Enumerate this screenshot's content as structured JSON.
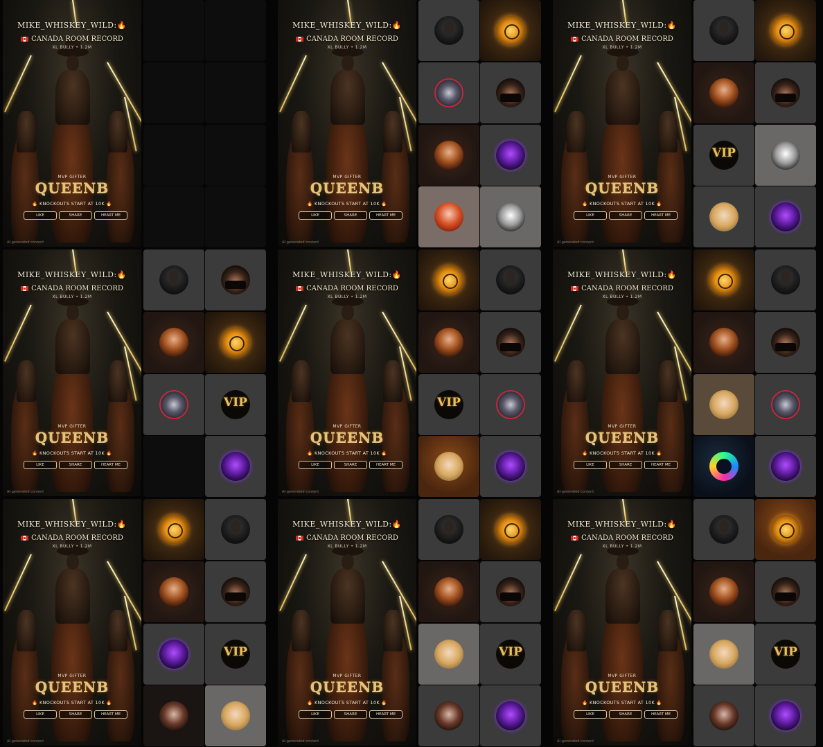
{
  "poster": {
    "name": "MIKE_WHISKEY_WILD:",
    "fire_emoji": "🔥",
    "record": "CANADA ROOM RECORD",
    "subtitle": "XL BULLY • 1.2M",
    "gifter_label": "MVP GIFTER",
    "gifter_name": "QUEENB",
    "knockouts": "KNOCKOUTS START AT 10K",
    "buttons": [
      "LIKE",
      "SHARE",
      "HEART ME"
    ],
    "ai_notice": "AI-generated content"
  },
  "panels": [
    {
      "tiles": [
        {
          "style": "empty",
          "avatar": "none",
          "icon": "empty-slot"
        },
        {
          "style": "empty",
          "avatar": "none",
          "icon": "empty-slot"
        },
        {
          "style": "empty",
          "avatar": "none",
          "icon": "empty-slot"
        },
        {
          "style": "empty",
          "avatar": "none",
          "icon": "empty-slot"
        },
        {
          "style": "empty",
          "avatar": "none",
          "icon": "empty-slot"
        },
        {
          "style": "empty",
          "avatar": "none",
          "icon": "empty-slot"
        },
        {
          "style": "empty",
          "avatar": "none",
          "icon": "empty-slot"
        },
        {
          "style": "empty",
          "avatar": "none",
          "icon": "empty-slot"
        }
      ]
    },
    {
      "tiles": [
        {
          "style": "grey",
          "avatar": "dark",
          "icon": "user-avatar"
        },
        {
          "style": "gold",
          "avatar": "gold",
          "icon": "gold-crest-avatar"
        },
        {
          "style": "grey",
          "avatar": "mil",
          "icon": "mil-badge-avatar"
        },
        {
          "style": "grey",
          "avatar": "mask",
          "icon": "masked-user-avatar"
        },
        {
          "style": "warm",
          "avatar": "fire",
          "icon": "user-avatar"
        },
        {
          "style": "grey",
          "avatar": "cup",
          "icon": "cup-of-tea-avatar"
        },
        {
          "style": "pale",
          "avatar": "red",
          "icon": "redhead-user-avatar"
        },
        {
          "style": "lightgrey",
          "avatar": "white",
          "icon": "white-figure-avatar"
        }
      ]
    },
    {
      "tiles": [
        {
          "style": "grey",
          "avatar": "dark",
          "icon": "user-avatar"
        },
        {
          "style": "gold",
          "avatar": "gold",
          "icon": "gold-crest-avatar"
        },
        {
          "style": "warm",
          "avatar": "fire",
          "icon": "user-avatar"
        },
        {
          "style": "grey",
          "avatar": "mask",
          "icon": "masked-user-avatar"
        },
        {
          "style": "grey",
          "avatar": "vip",
          "icon": "vip-avatar"
        },
        {
          "style": "lightgrey",
          "avatar": "white",
          "icon": "white-figure-avatar"
        },
        {
          "style": "grey",
          "avatar": "blonde",
          "icon": "blonde-user-avatar"
        },
        {
          "style": "grey",
          "avatar": "cup",
          "icon": "cup-of-tea-avatar"
        }
      ]
    },
    {
      "tiles": [
        {
          "style": "grey",
          "avatar": "dark",
          "icon": "user-avatar"
        },
        {
          "style": "grey",
          "avatar": "mask",
          "icon": "masked-user-avatar"
        },
        {
          "style": "warm",
          "avatar": "fire",
          "icon": "user-avatar"
        },
        {
          "style": "gold",
          "avatar": "gold",
          "icon": "gold-crest-avatar"
        },
        {
          "style": "grey",
          "avatar": "mil",
          "icon": "mil-badge-avatar"
        },
        {
          "style": "grey",
          "avatar": "vip",
          "icon": "vip-avatar"
        },
        {
          "style": "empty",
          "avatar": "none",
          "icon": "empty-slot"
        },
        {
          "style": "grey",
          "avatar": "cup",
          "icon": "cup-of-tea-avatar"
        }
      ]
    },
    {
      "tiles": [
        {
          "style": "gold",
          "avatar": "gold",
          "icon": "gold-crest-avatar"
        },
        {
          "style": "grey",
          "avatar": "dark",
          "icon": "user-avatar"
        },
        {
          "style": "warm",
          "avatar": "fire",
          "icon": "user-avatar"
        },
        {
          "style": "grey",
          "avatar": "mask",
          "icon": "masked-user-avatar"
        },
        {
          "style": "grey",
          "avatar": "vip",
          "icon": "vip-avatar"
        },
        {
          "style": "grey",
          "avatar": "mil",
          "icon": "mil-badge-avatar"
        },
        {
          "style": "amber",
          "avatar": "blonde",
          "icon": "blonde-user-avatar"
        },
        {
          "style": "grey",
          "avatar": "cup",
          "icon": "cup-of-tea-avatar"
        }
      ]
    },
    {
      "tiles": [
        {
          "style": "gold",
          "avatar": "gold",
          "icon": "gold-crest-avatar"
        },
        {
          "style": "grey",
          "avatar": "dark",
          "icon": "user-avatar"
        },
        {
          "style": "warm",
          "avatar": "fire",
          "icon": "user-avatar"
        },
        {
          "style": "grey",
          "avatar": "mask",
          "icon": "masked-user-avatar"
        },
        {
          "style": "brown",
          "avatar": "blonde",
          "icon": "blonde-user-avatar"
        },
        {
          "style": "grey",
          "avatar": "mil",
          "icon": "mil-badge-avatar"
        },
        {
          "style": "neon",
          "avatar": "neon",
          "icon": "neon-badge-avatar"
        },
        {
          "style": "grey",
          "avatar": "cup",
          "icon": "cup-of-tea-avatar"
        }
      ]
    },
    {
      "tiles": [
        {
          "style": "gold",
          "avatar": "gold",
          "icon": "gold-crest-avatar"
        },
        {
          "style": "grey",
          "avatar": "dark",
          "icon": "user-avatar"
        },
        {
          "style": "warm",
          "avatar": "fire",
          "icon": "user-avatar"
        },
        {
          "style": "grey",
          "avatar": "mask",
          "icon": "masked-user-avatar"
        },
        {
          "style": "grey",
          "avatar": "cup",
          "icon": "cup-of-tea-avatar"
        },
        {
          "style": "grey",
          "avatar": "vip",
          "icon": "vip-avatar"
        },
        {
          "style": "dark",
          "avatar": "glasses",
          "icon": "glasses-user-avatar"
        },
        {
          "style": "lightgrey",
          "avatar": "blonde",
          "icon": "blonde-user-avatar"
        }
      ]
    },
    {
      "tiles": [
        {
          "style": "grey",
          "avatar": "dark",
          "icon": "user-avatar"
        },
        {
          "style": "gold",
          "avatar": "gold",
          "icon": "gold-crest-avatar"
        },
        {
          "style": "warm",
          "avatar": "fire",
          "icon": "user-avatar"
        },
        {
          "style": "grey",
          "avatar": "mask",
          "icon": "masked-user-avatar"
        },
        {
          "style": "lightgrey",
          "avatar": "blonde",
          "icon": "blonde-user-avatar"
        },
        {
          "style": "grey",
          "avatar": "vip",
          "icon": "vip-avatar"
        },
        {
          "style": "grey",
          "avatar": "glasses",
          "icon": "glasses-user-avatar"
        },
        {
          "style": "grey",
          "avatar": "cup",
          "icon": "cup-of-tea-avatar"
        }
      ]
    },
    {
      "tiles": [
        {
          "style": "grey",
          "avatar": "dark",
          "icon": "user-avatar"
        },
        {
          "style": "amber",
          "avatar": "gold",
          "icon": "gold-crest-avatar"
        },
        {
          "style": "warm",
          "avatar": "fire",
          "icon": "user-avatar"
        },
        {
          "style": "grey",
          "avatar": "mask",
          "icon": "masked-user-avatar"
        },
        {
          "style": "lightgrey",
          "avatar": "blonde",
          "icon": "blonde-user-avatar"
        },
        {
          "style": "grey",
          "avatar": "vip",
          "icon": "vip-avatar"
        },
        {
          "style": "grey",
          "avatar": "glasses",
          "icon": "glasses-user-avatar"
        },
        {
          "style": "grey",
          "avatar": "cup",
          "icon": "cup-of-tea-avatar"
        }
      ]
    }
  ],
  "vip_text": "VIP"
}
